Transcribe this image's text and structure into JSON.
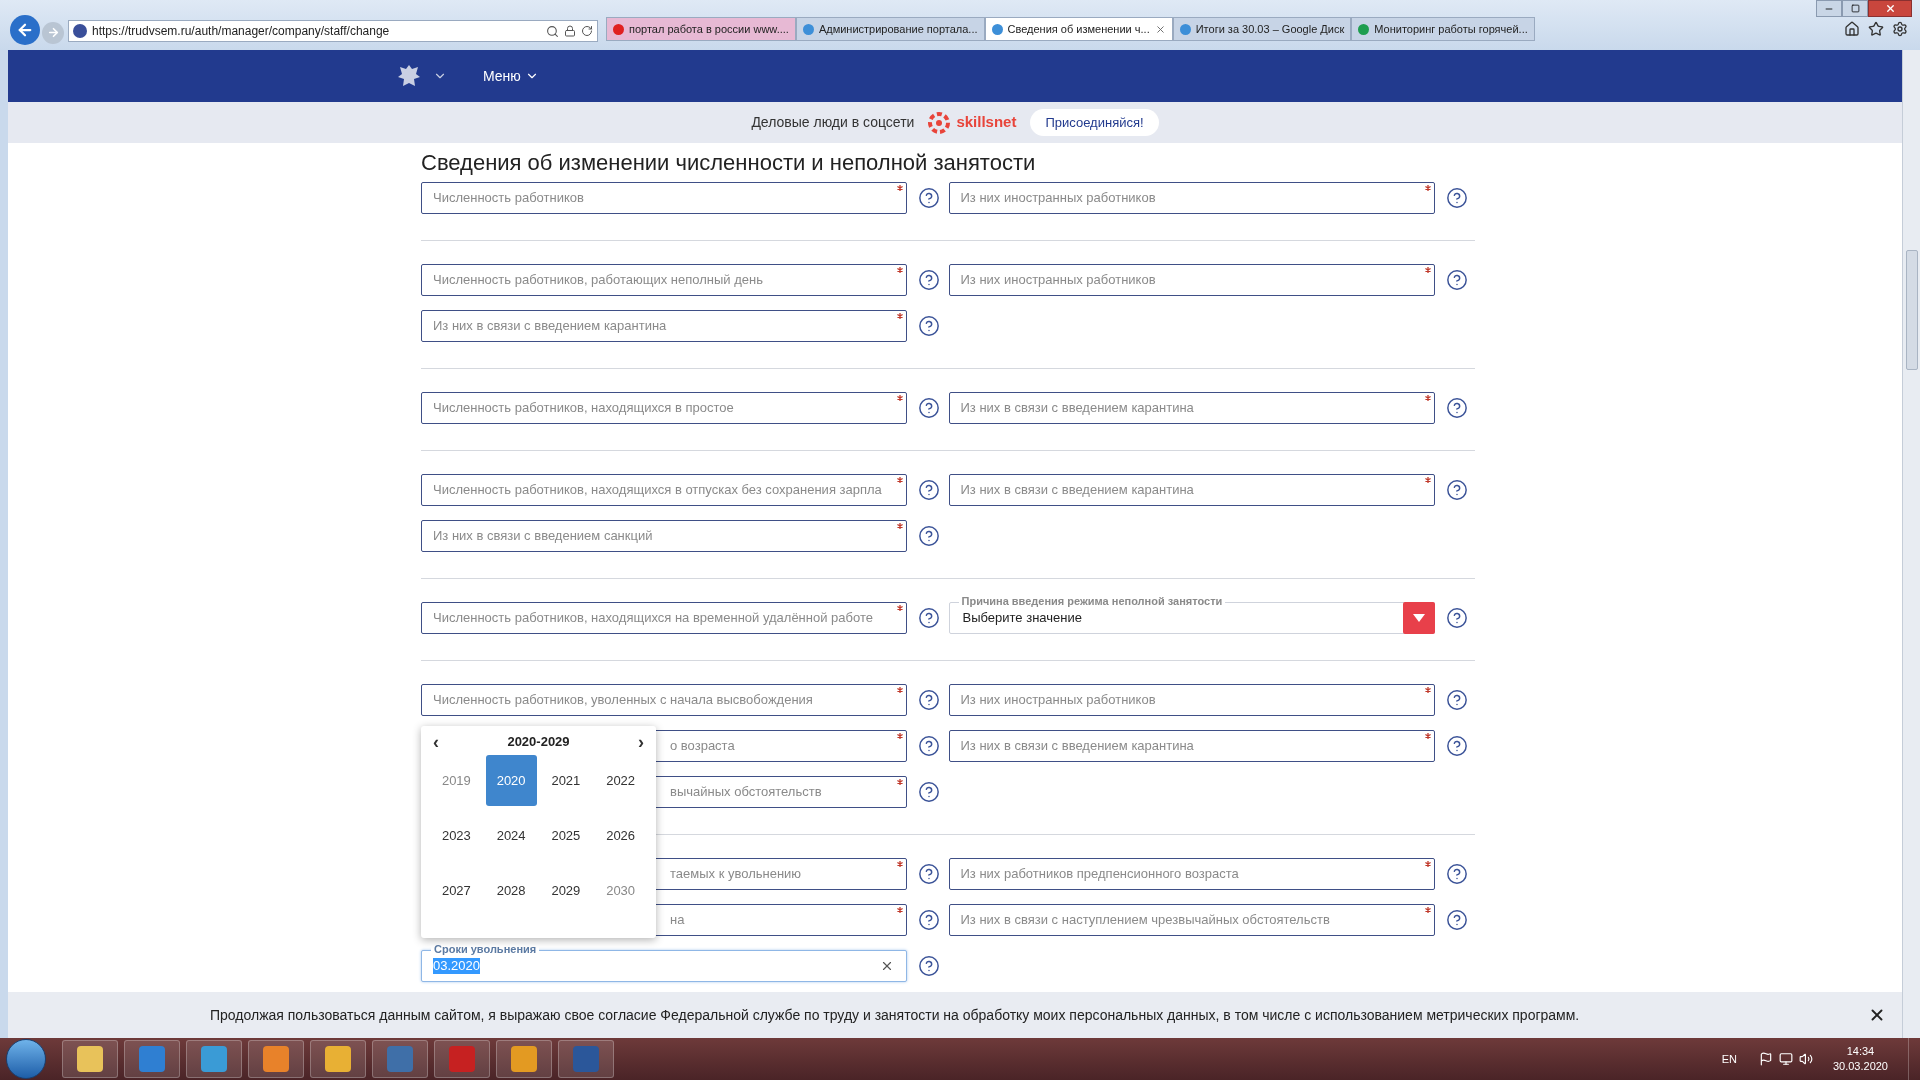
{
  "browser": {
    "url": "https://trudvsem.ru/auth/manager/company/staff/change",
    "tabs": [
      {
        "label": "портал работа в россии www....",
        "selected": false
      },
      {
        "label": "Администрирование портала...",
        "selected": false
      },
      {
        "label": "Сведения об изменении ч...",
        "selected": true
      },
      {
        "label": "Итоги за 30.03 – Google Диск",
        "selected": false
      },
      {
        "label": "Мониторинг работы горячей...",
        "selected": false
      }
    ]
  },
  "nav": {
    "menu": "Меню"
  },
  "promo": {
    "text": "Деловые люди в соцсети",
    "brand": "skillsnet",
    "button": "Присоединяйся!"
  },
  "title": "Сведения об изменении численности и неполной занятости",
  "sections": [
    {
      "rows": [
        {
          "left": {
            "kind": "input",
            "placeholder": "Численность работников",
            "required": true
          },
          "right": {
            "kind": "input",
            "placeholder": "Из них иностранных работников",
            "required": true
          }
        }
      ]
    },
    {
      "rows": [
        {
          "left": {
            "kind": "input",
            "placeholder": "Численность работников, работающих неполный день",
            "required": true
          },
          "right": {
            "kind": "input",
            "placeholder": "Из них иностранных работников",
            "required": true
          }
        },
        {
          "left": {
            "kind": "input",
            "placeholder": "Из них в связи с введением карантина",
            "required": true
          }
        }
      ]
    },
    {
      "rows": [
        {
          "left": {
            "kind": "input",
            "placeholder": "Численность работников, находящихся в простое",
            "required": true
          },
          "right": {
            "kind": "input",
            "placeholder": "Из них в связи с введением карантина",
            "required": true
          }
        }
      ]
    },
    {
      "rows": [
        {
          "left": {
            "kind": "input",
            "placeholder": "Численность работников, находящихся в отпусках без сохранения зарпла",
            "required": true
          },
          "right": {
            "kind": "input",
            "placeholder": "Из них в связи с введением карантина",
            "required": true
          }
        },
        {
          "left": {
            "kind": "input",
            "placeholder": "Из них в связи с введением санкций",
            "required": true
          }
        }
      ]
    },
    {
      "rows": [
        {
          "left": {
            "kind": "input",
            "placeholder": "Численность работников, находящихся на временной удалённой работе",
            "required": true
          },
          "right": {
            "kind": "select",
            "legend": "Причина введения режима неполной занятости",
            "value": "Выберите значение"
          }
        }
      ]
    },
    {
      "rows": [
        {
          "left": {
            "kind": "input",
            "placeholder": "Численность работников, уволенных с начала высвобождения",
            "required": true
          },
          "right": {
            "kind": "input",
            "placeholder": "Из них иностранных работников",
            "required": true
          }
        },
        {
          "left": {
            "kind": "covered",
            "placeholder": "о возраста",
            "required": true
          },
          "right": {
            "kind": "input",
            "placeholder": "Из них в связи с введением карантина",
            "required": true
          }
        },
        {
          "left": {
            "kind": "covered",
            "placeholder": "вычайных обстоятельств",
            "required": true
          }
        }
      ]
    },
    {
      "rows": [
        {
          "left": {
            "kind": "covered",
            "placeholder": "таемых к увольнению",
            "required": true
          },
          "right": {
            "kind": "input",
            "placeholder": "Из них работников предпенсионного возраста",
            "required": true
          }
        },
        {
          "left": {
            "kind": "covered",
            "placeholder": "на",
            "required": true
          },
          "right": {
            "kind": "input",
            "placeholder": "Из них в связи с наступлением чрезвычайных обстоятельств",
            "required": true
          }
        },
        {
          "left": {
            "kind": "date",
            "legend": "Сроки увольнения",
            "value": "03.2020"
          }
        }
      ]
    }
  ],
  "picker": {
    "range": "2020-2029",
    "prev": "‹",
    "next": "›",
    "years": [
      {
        "label": "2019",
        "selected": false,
        "outside": true
      },
      {
        "label": "2020",
        "selected": true,
        "outside": false
      },
      {
        "label": "2021",
        "selected": false,
        "outside": false
      },
      {
        "label": "2022",
        "selected": false,
        "outside": false
      },
      {
        "label": "2023",
        "selected": false,
        "outside": false
      },
      {
        "label": "2024",
        "selected": false,
        "outside": false
      },
      {
        "label": "2025",
        "selected": false,
        "outside": false
      },
      {
        "label": "2026",
        "selected": false,
        "outside": false
      },
      {
        "label": "2027",
        "selected": false,
        "outside": false
      },
      {
        "label": "2028",
        "selected": false,
        "outside": false
      },
      {
        "label": "2029",
        "selected": false,
        "outside": false
      },
      {
        "label": "2030",
        "selected": false,
        "outside": true
      }
    ]
  },
  "cookie": {
    "text": "Продолжая пользоваться данным сайтом, я выражаю свое согласие Федеральной службе по труду и занятости на обработку моих персональных данных, в том числе с использованием метрических программ."
  },
  "taskbar": {
    "lang": "EN",
    "time": "14:34",
    "date": "30.03.2020"
  }
}
